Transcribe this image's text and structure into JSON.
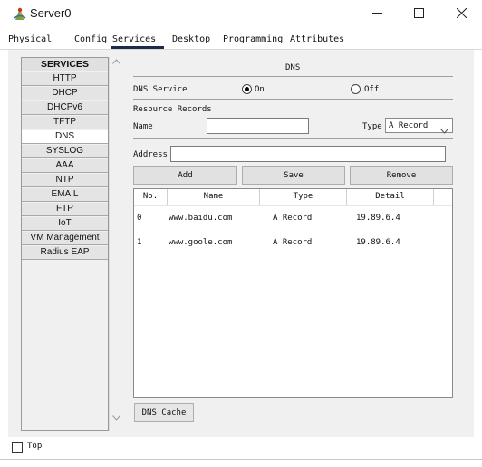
{
  "window": {
    "title": "Server0",
    "icon": "server-icon",
    "controls": {
      "minimize_icon": "minimize-icon",
      "maximize_icon": "maximize-icon",
      "close_icon": "close-icon"
    }
  },
  "tabs": [
    {
      "label": "Physical"
    },
    {
      "label": "Config"
    },
    {
      "label": "Services"
    },
    {
      "label": "Desktop"
    },
    {
      "label": "Programming"
    },
    {
      "label": "Attributes"
    }
  ],
  "active_tab": "Services",
  "services": {
    "header": "SERVICES",
    "items": [
      {
        "label": "HTTP"
      },
      {
        "label": "DHCP"
      },
      {
        "label": "DHCPv6"
      },
      {
        "label": "TFTP"
      },
      {
        "label": "DNS"
      },
      {
        "label": "SYSLOG"
      },
      {
        "label": "AAA"
      },
      {
        "label": "NTP"
      },
      {
        "label": "EMAIL"
      },
      {
        "label": "FTP"
      },
      {
        "label": "IoT"
      },
      {
        "label": "VM Management"
      },
      {
        "label": "Radius EAP"
      }
    ],
    "active": "DNS"
  },
  "dns": {
    "title": "DNS",
    "service_label": "DNS Service",
    "on_label": "On",
    "off_label": "Off",
    "service_state": "On",
    "resource_records_label": "Resource Records",
    "name_label": "Name",
    "name_value": "",
    "type_label": "Type",
    "type_value": "A Record",
    "address_label": "Address",
    "address_value": "",
    "add_button": "Add",
    "save_button": "Save",
    "remove_button": "Remove",
    "table": {
      "columns": [
        "No.",
        "Name",
        "Type",
        "Detail"
      ],
      "rows": [
        {
          "no": "0",
          "name": "www.baidu.com",
          "type": "A Record",
          "detail": "19.89.6.4"
        },
        {
          "no": "1",
          "name": "www.goole.com",
          "type": "A Record",
          "detail": "19.89.6.4"
        }
      ]
    },
    "cache_button": "DNS Cache"
  },
  "top_checkbox": {
    "label": "Top",
    "checked": false
  },
  "colors": {
    "accent": "#1c2b48",
    "panel_bg": "#f0f0f0",
    "list_item_bg": "#e4e4e4",
    "list_item_active_bg": "#ffffff",
    "button_bg": "#e1e1e1"
  }
}
